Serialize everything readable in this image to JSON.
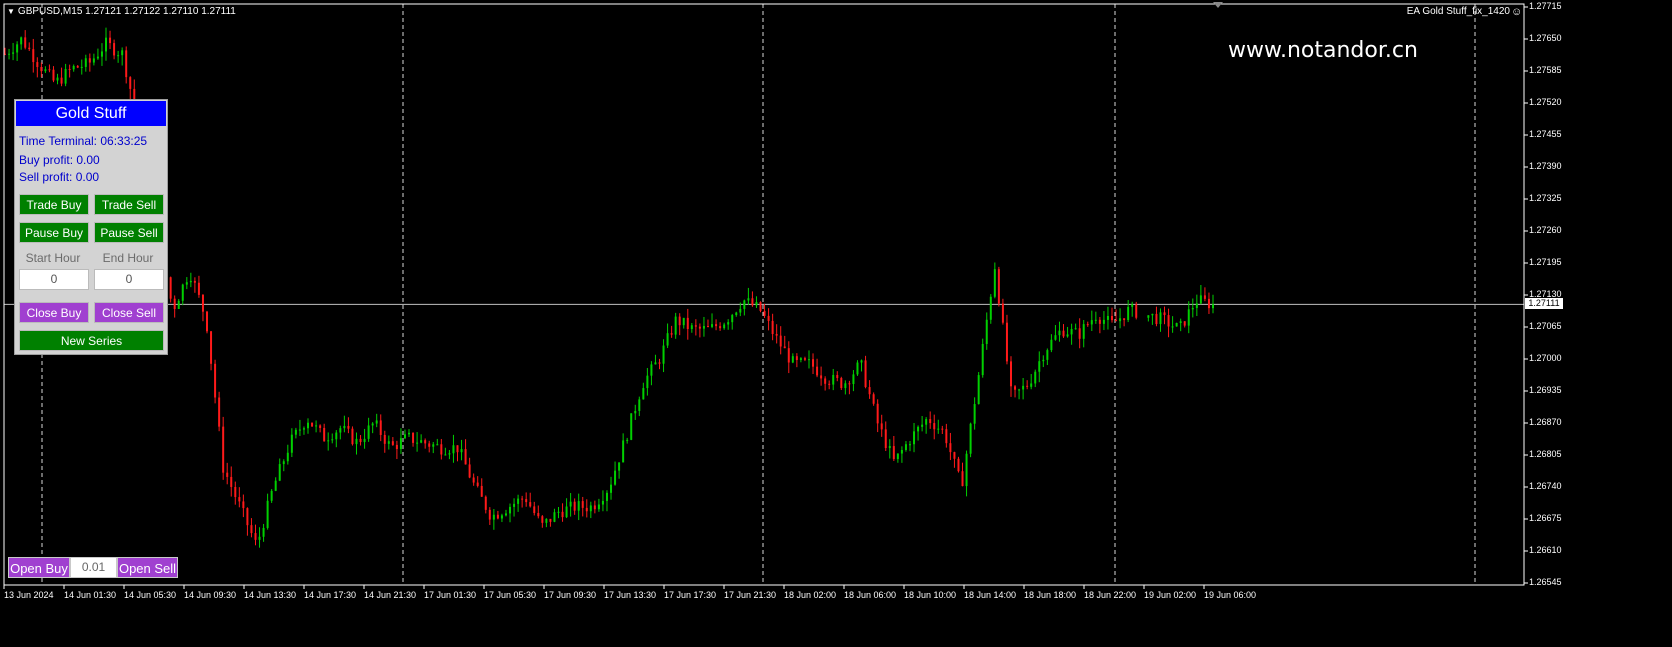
{
  "header": {
    "symbol_info": "GBPUSD,M15  1.27121 1.27122 1.27110 1.27111",
    "expert_label": "EA Gold Stuff_fix_1420",
    "watermark": "www.notandor.cn"
  },
  "panel": {
    "title": "Gold Stuff",
    "time_terminal": "Time Terminal: 06:33:25",
    "buy_profit": "Buy profit: 0.00",
    "sell_profit": "Sell profit: 0.00",
    "trade_buy": "Trade Buy",
    "trade_sell": "Trade Sell",
    "pause_buy": "Pause Buy",
    "pause_sell": "Pause Sell",
    "start_hour_label": "Start Hour",
    "end_hour_label": "End Hour",
    "start_hour_value": "0",
    "end_hour_value": "0",
    "close_buy": "Close Buy",
    "close_sell": "Close Sell",
    "new_series": "New Series"
  },
  "order_bar": {
    "open_buy": "Open Buy",
    "lot": "0.01",
    "open_sell": "Open Sell"
  },
  "price_axis": {
    "ticks": [
      "1.27715",
      "1.27650",
      "1.27585",
      "1.27520",
      "1.27455",
      "1.27390",
      "1.27325",
      "1.27260",
      "1.27195",
      "1.27130",
      "1.27065",
      "1.27000",
      "1.26935",
      "1.26870",
      "1.26805",
      "1.26740",
      "1.26675",
      "1.26610",
      "1.26545"
    ],
    "current_price": "1.27111"
  },
  "time_axis": {
    "ticks": [
      "13 Jun 2024",
      "14 Jun 01:30",
      "14 Jun 05:30",
      "14 Jun 09:30",
      "14 Jun 13:30",
      "14 Jun 17:30",
      "14 Jun 21:30",
      "17 Jun 01:30",
      "17 Jun 05:30",
      "17 Jun 09:30",
      "17 Jun 13:30",
      "17 Jun 17:30",
      "17 Jun 21:30",
      "18 Jun 02:00",
      "18 Jun 06:00",
      "18 Jun 10:00",
      "18 Jun 14:00",
      "18 Jun 18:00",
      "18 Jun 22:00",
      "19 Jun 02:00",
      "19 Jun 06:00"
    ]
  },
  "colors": {
    "background": "#000000",
    "bull": "#00d000",
    "bear": "#ff1a1a",
    "panel_title": "#0000ff",
    "button_green": "#008000",
    "button_purple": "#a040d0"
  },
  "chart_data": {
    "type": "candlestick",
    "symbol": "GBPUSD",
    "timeframe": "M15",
    "ylim": [
      1.26535,
      1.27735
    ],
    "current_price": 1.27111,
    "close_path": [
      [
        0,
        1.2762
      ],
      [
        2,
        1.2765
      ],
      [
        4,
        1.276
      ],
      [
        6,
        1.2756
      ],
      [
        8,
        1.2759
      ],
      [
        10,
        1.276
      ],
      [
        12,
        1.2764
      ],
      [
        14,
        1.2762
      ],
      [
        16,
        1.2747
      ],
      [
        18,
        1.2728
      ],
      [
        20,
        1.271
      ],
      [
        22,
        1.2718
      ],
      [
        24,
        1.2708
      ],
      [
        26,
        1.2678
      ],
      [
        28,
        1.267
      ],
      [
        30,
        1.2662
      ],
      [
        32,
        1.2674
      ],
      [
        34,
        1.2683
      ],
      [
        36,
        1.2688
      ],
      [
        38,
        1.2684
      ],
      [
        40,
        1.2686
      ],
      [
        42,
        1.2683
      ],
      [
        44,
        1.2687
      ],
      [
        46,
        1.2682
      ],
      [
        48,
        1.2684
      ],
      [
        50,
        1.2683
      ],
      [
        52,
        1.2682
      ],
      [
        54,
        1.2682
      ],
      [
        56,
        1.2674
      ],
      [
        58,
        1.2668
      ],
      [
        60,
        1.267
      ],
      [
        62,
        1.2672
      ],
      [
        64,
        1.2666
      ],
      [
        66,
        1.2669
      ],
      [
        68,
        1.267
      ],
      [
        70,
        1.267
      ],
      [
        72,
        1.2674
      ],
      [
        74,
        1.2684
      ],
      [
        76,
        1.2695
      ],
      [
        78,
        1.27
      ],
      [
        80,
        1.2708
      ],
      [
        82,
        1.2706
      ],
      [
        84,
        1.2706
      ],
      [
        86,
        1.2708
      ],
      [
        88,
        1.2712
      ],
      [
        90,
        1.271
      ],
      [
        92,
        1.2704
      ],
      [
        94,
        1.2699
      ],
      [
        96,
        1.2699
      ],
      [
        98,
        1.2696
      ],
      [
        100,
        1.2695
      ],
      [
        102,
        1.2699
      ],
      [
        104,
        1.2687
      ],
      [
        106,
        1.2679
      ],
      [
        108,
        1.2684
      ],
      [
        110,
        1.2688
      ],
      [
        112,
        1.2685
      ],
      [
        114,
        1.2674
      ],
      [
        116,
        1.2696
      ],
      [
        118,
        1.2719
      ],
      [
        120,
        1.2692
      ],
      [
        122,
        1.2695
      ],
      [
        124,
        1.2702
      ],
      [
        126,
        1.2706
      ],
      [
        128,
        1.2705
      ],
      [
        130,
        1.2709
      ],
      [
        132,
        1.2707
      ],
      [
        134,
        1.271
      ],
      [
        136,
        1.2709
      ],
      [
        138,
        1.2708
      ],
      [
        140,
        1.2706
      ],
      [
        142,
        1.2712
      ],
      [
        144,
        1.27111
      ]
    ]
  }
}
